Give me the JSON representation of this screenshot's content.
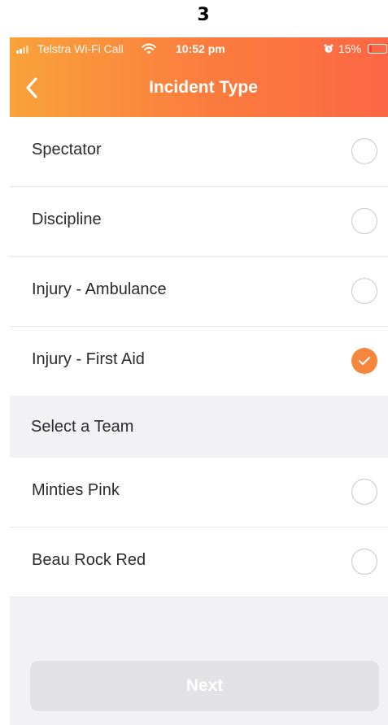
{
  "step_number": "3",
  "status_bar": {
    "carrier": "Telstra Wi-Fi Call",
    "time": "10:52 pm",
    "battery": "15%"
  },
  "header": {
    "title": "Incident Type"
  },
  "incident_types": [
    {
      "label": "Spectator",
      "selected": false
    },
    {
      "label": "Discipline",
      "selected": false
    },
    {
      "label": "Injury - Ambulance",
      "selected": false
    },
    {
      "label": "Injury - First Aid",
      "selected": true
    }
  ],
  "team_section": {
    "title": "Select a Team",
    "teams": [
      {
        "label": "Minties Pink",
        "selected": false
      },
      {
        "label": "Beau Rock Red",
        "selected": false
      }
    ]
  },
  "next_button": {
    "label": "Next",
    "enabled": false
  },
  "colors": {
    "accent": "#f7863d",
    "header_gradient_start": "#f9a23a",
    "header_gradient_end": "#fc6745",
    "disabled_button": "#e2e2e5"
  }
}
